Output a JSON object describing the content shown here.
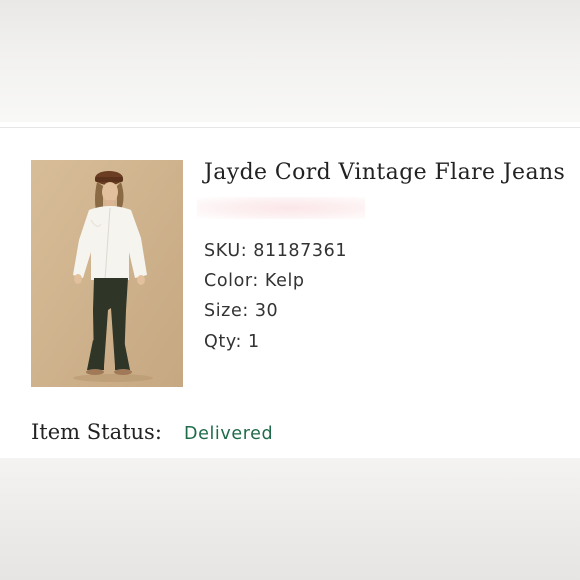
{
  "order_item": {
    "product_name": "Jayde Cord Vintage Flare Jeans",
    "image_alt": "Model wearing Jayde Cord Vintage Flare Jeans",
    "details": [
      {
        "label": "SKU:",
        "value": "81187361"
      },
      {
        "label": "Color:",
        "value": "Kelp"
      },
      {
        "label": "Size:",
        "value": "30"
      },
      {
        "label": "Qty:",
        "value": "1"
      }
    ],
    "status_label": "Item Status:",
    "status_value": "Delivered"
  },
  "colors": {
    "status_green": "#1f6b4a",
    "photo_background": "#cdb28d"
  }
}
